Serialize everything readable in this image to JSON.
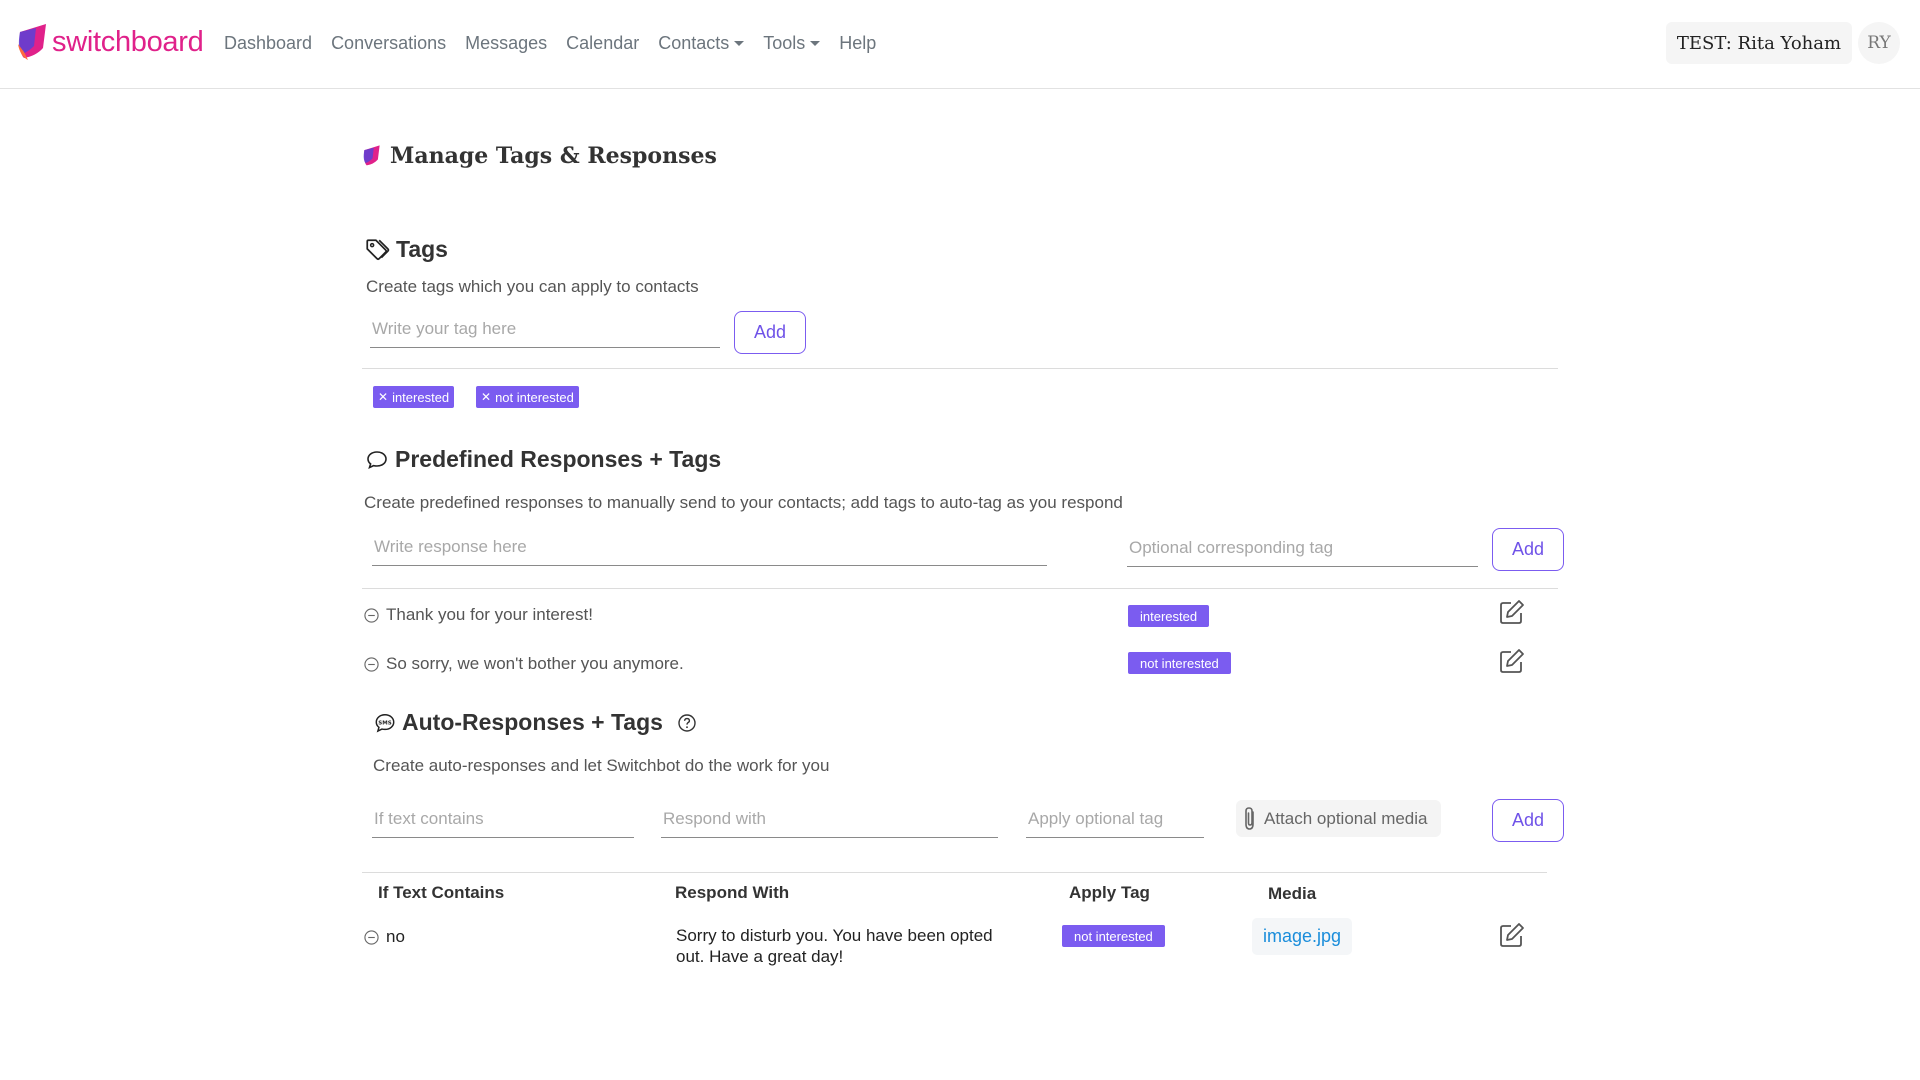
{
  "brand": {
    "name": "switchboard"
  },
  "nav": {
    "items": [
      {
        "label": "Dashboard"
      },
      {
        "label": "Conversations"
      },
      {
        "label": "Messages"
      },
      {
        "label": "Calendar"
      },
      {
        "label": "Contacts",
        "dropdown": true
      },
      {
        "label": "Tools",
        "dropdown": true
      },
      {
        "label": "Help"
      }
    ],
    "user_label": "TEST: Rita Yoham",
    "user_initials": "RY"
  },
  "page": {
    "title": "Manage Tags & Responses"
  },
  "tags": {
    "heading": "Tags",
    "description": "Create tags which you can apply to contacts",
    "input_placeholder": "Write your tag here",
    "add_label": "Add",
    "items": [
      "interested",
      "not interested"
    ]
  },
  "predefined": {
    "heading": "Predefined Responses + Tags",
    "description": "Create predefined responses to manually send to your contacts; add tags to auto-tag as you respond",
    "response_placeholder": "Write response here",
    "tag_placeholder": "Optional corresponding tag",
    "add_label": "Add",
    "rows": [
      {
        "text": "Thank you for your interest!",
        "tag": "interested"
      },
      {
        "text": "So sorry, we won't bother you anymore.",
        "tag": "not interested"
      }
    ]
  },
  "auto": {
    "heading": "Auto-Responses + Tags",
    "description": "Create auto-responses and let Switchbot do the work for you",
    "if_placeholder": "If text contains",
    "respond_placeholder": "Respond with",
    "tag_placeholder": "Apply optional tag",
    "attach_label": "Attach optional media",
    "add_label": "Add",
    "columns": [
      "If Text Contains",
      "Respond With",
      "Apply Tag",
      "Media"
    ],
    "rows": [
      {
        "contains": "no",
        "respond_line1": "Sorry to disturb you. You have been opted",
        "respond_line2": "out. Have a great day!",
        "tag": "not interested",
        "media": "image.jpg"
      }
    ]
  },
  "colors": {
    "accent": "#7b5cf0",
    "brand": "#e0218a",
    "link": "#1a8ddb"
  }
}
